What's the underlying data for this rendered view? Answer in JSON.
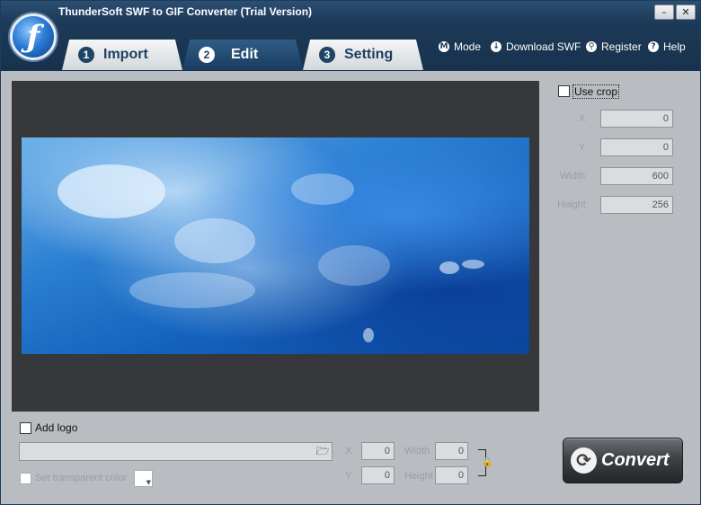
{
  "window": {
    "title": "ThunderSoft SWF to GIF Converter (Trial Version)",
    "minimize_glyph": "–",
    "restore_glyph": "□",
    "close_glyph": "✕"
  },
  "tabs": [
    {
      "number": "1",
      "label": "Import",
      "active": false
    },
    {
      "number": "2",
      "label": "Edit",
      "active": true
    },
    {
      "number": "3",
      "label": "Setting",
      "active": false
    }
  ],
  "menu": {
    "mode": {
      "label": "Mode",
      "icon": "M"
    },
    "download": {
      "label": "Download SWF",
      "icon": "↓"
    },
    "register": {
      "label": "Register",
      "icon": "⚲"
    },
    "help": {
      "label": "Help",
      "icon": "?"
    }
  },
  "crop": {
    "use_crop_label": "Use crop",
    "checked": false,
    "x_label": "X",
    "x_value": "0",
    "y_label": "Y",
    "y_value": "0",
    "width_label": "Width",
    "width_value": "600",
    "height_label": "Height",
    "height_value": "256"
  },
  "logo": {
    "add_logo_label": "Add logo",
    "checked": false,
    "path_value": "",
    "transparent_label": "Set transparent color",
    "x_label": "X",
    "x_value": "0",
    "y_label": "Y",
    "y_value": "0",
    "width_label": "Width",
    "width_value": "0",
    "height_label": "Height",
    "height_value": "0"
  },
  "convert": {
    "label": "Convert"
  },
  "colors": {
    "titlebar": "#1d3a58",
    "active_tab": "#193c5f",
    "preview_bg": "#36383b",
    "panel_bg": "#b9bcc0"
  }
}
